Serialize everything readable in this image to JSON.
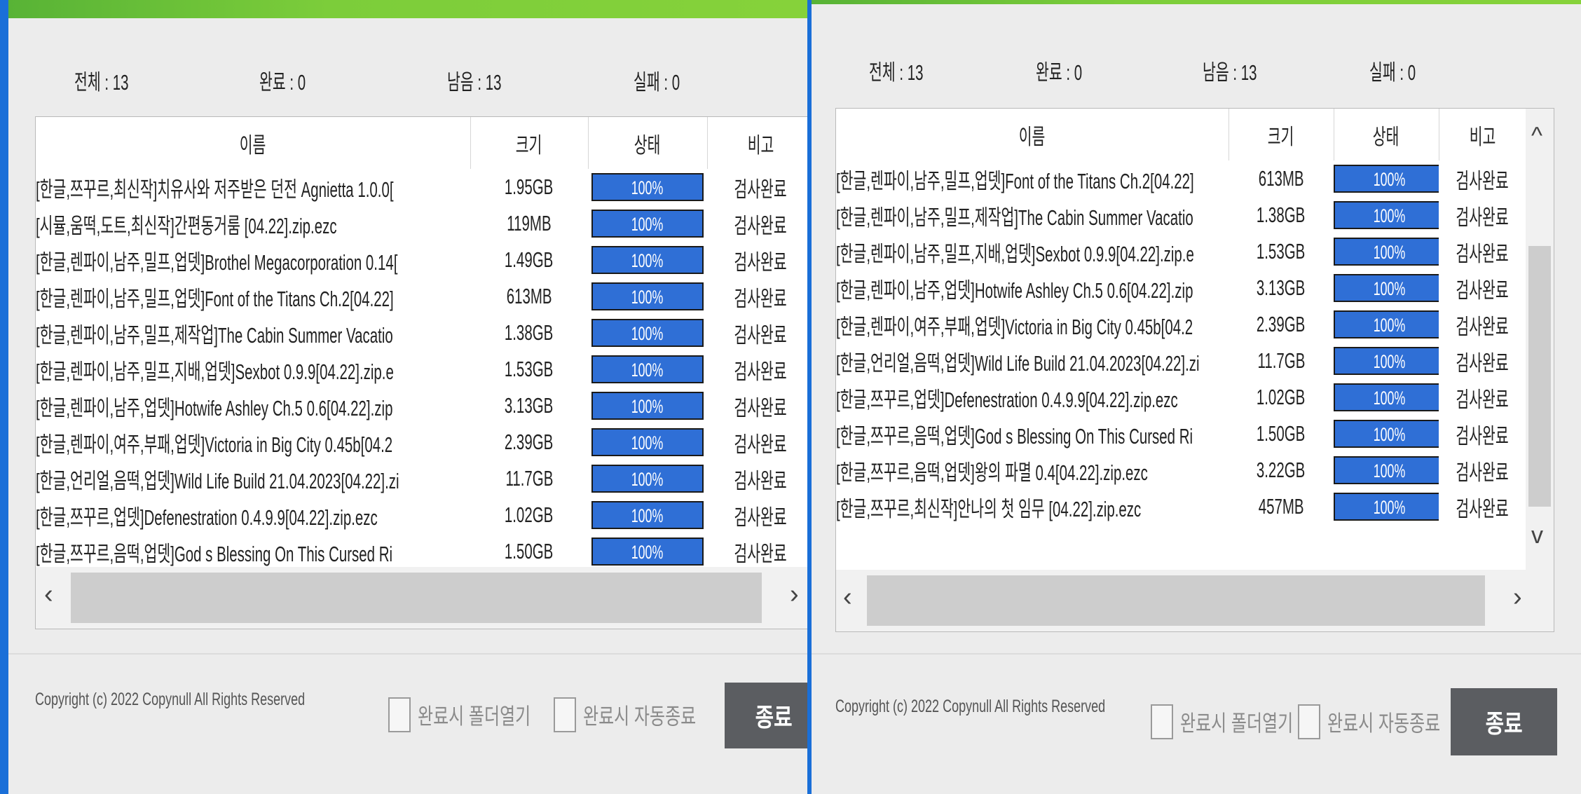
{
  "columns": [
    "이름",
    "크기",
    "상태",
    "비고"
  ],
  "left_window": {
    "stats": {
      "total_label": "전체",
      "total_value": "13",
      "done_label": "완료",
      "done_value": "0",
      "remain_label": "남음",
      "remain_value": "13",
      "fail_label": "실패",
      "fail_value": "0"
    },
    "rows": [
      {
        "name": "[한글,쯔꾸르,최신작]치유사와 저주받은 던전 Agnietta 1.0.0[",
        "size": "1.95GB",
        "progress": 100,
        "status": "100%",
        "note": "검사완료"
      },
      {
        "name": "[시뮬,움떡,도트,최신작]간편동거룸 [04.22].zip.ezc",
        "size": "119MB",
        "progress": 100,
        "status": "100%",
        "note": "검사완료"
      },
      {
        "name": "[한글,렌파이,남주,밀프,업뎃]Brothel Megacorporation 0.14[",
        "size": "1.49GB",
        "progress": 100,
        "status": "100%",
        "note": "검사완료"
      },
      {
        "name": "[한글,렌파이,남주,밀프,업뎃]Font of the Titans Ch.2[04.22]",
        "size": "613MB",
        "progress": 100,
        "status": "100%",
        "note": "검사완료"
      },
      {
        "name": "[한글,렌파이,남주,밀프,제작업]The Cabin Summer Vacatio",
        "size": "1.38GB",
        "progress": 100,
        "status": "100%",
        "note": "검사완료"
      },
      {
        "name": "[한글,렌파이,남주,밀프,지배,업뎃]Sexbot 0.9.9[04.22].zip.e",
        "size": "1.53GB",
        "progress": 100,
        "status": "100%",
        "note": "검사완료"
      },
      {
        "name": "[한글,렌파이,남주,업뎃]Hotwife Ashley Ch.5 0.6[04.22].zip",
        "size": "3.13GB",
        "progress": 100,
        "status": "100%",
        "note": "검사완료"
      },
      {
        "name": "[한글,렌파이,여주,부패,업뎃]Victoria in Big City 0.45b[04.2",
        "size": "2.39GB",
        "progress": 100,
        "status": "100%",
        "note": "검사완료"
      },
      {
        "name": "[한글,언리얼,음떡,업뎃]Wild Life Build 21.04.2023[04.22].zi",
        "size": "11.7GB",
        "progress": 100,
        "status": "100%",
        "note": "검사완료"
      },
      {
        "name": "[한글,쯔꾸르,업뎃]Defenestration 0.4.9.9[04.22].zip.ezc",
        "size": "1.02GB",
        "progress": 100,
        "status": "100%",
        "note": "검사완료"
      },
      {
        "name": "[한글,쯔꾸르,음떡,업뎃]God s Blessing On This Cursed Ri",
        "size": "1.50GB",
        "progress": 100,
        "status": "100%",
        "note": "검사완료"
      }
    ],
    "footer": {
      "copyright": "Copyright (c) 2022 Copynull All Rights Reserved",
      "open_folder_label": "완료시 폴더열기",
      "auto_exit_label": "완료시 자동종료",
      "exit_label": "종료"
    }
  },
  "right_window": {
    "stats": {
      "total_label": "전체",
      "total_value": "13",
      "done_label": "완료",
      "done_value": "0",
      "remain_label": "남음",
      "remain_value": "13",
      "fail_label": "실패",
      "fail_value": "0"
    },
    "rows": [
      {
        "name": "[한글,렌파이,남주,밀프,업뎃]Font of the Titans Ch.2[04.22]",
        "size": "613MB",
        "progress": 100,
        "status": "100%",
        "note": "검사완료"
      },
      {
        "name": "[한글,렌파이,남주,밀프,제작업]The Cabin Summer Vacatio",
        "size": "1.38GB",
        "progress": 100,
        "status": "100%",
        "note": "검사완료"
      },
      {
        "name": "[한글,렌파이,남주,밀프,지배,업뎃]Sexbot 0.9.9[04.22].zip.e",
        "size": "1.53GB",
        "progress": 100,
        "status": "100%",
        "note": "검사완료"
      },
      {
        "name": "[한글,렌파이,남주,업뎃]Hotwife Ashley Ch.5 0.6[04.22].zip",
        "size": "3.13GB",
        "progress": 100,
        "status": "100%",
        "note": "검사완료"
      },
      {
        "name": "[한글,렌파이,여주,부패,업뎃]Victoria in Big City 0.45b[04.2",
        "size": "2.39GB",
        "progress": 100,
        "status": "100%",
        "note": "검사완료"
      },
      {
        "name": "[한글,언리얼,음떡,업뎃]Wild Life Build 21.04.2023[04.22].zi",
        "size": "11.7GB",
        "progress": 100,
        "status": "100%",
        "note": "검사완료"
      },
      {
        "name": "[한글,쯔꾸르,업뎃]Defenestration 0.4.9.9[04.22].zip.ezc",
        "size": "1.02GB",
        "progress": 100,
        "status": "100%",
        "note": "검사완료"
      },
      {
        "name": "[한글,쯔꾸르,음떡,업뎃]God s Blessing On This Cursed Ri",
        "size": "1.50GB",
        "progress": 100,
        "status": "100%",
        "note": "검사완료"
      },
      {
        "name": "[한글,쯔꾸르,음떡,업뎃]왕의 파멸 0.4[04.22].zip.ezc",
        "size": "3.22GB",
        "progress": 100,
        "status": "100%",
        "note": "검사완료"
      },
      {
        "name": "[한글,쯔꾸르,최신작]안나의 첫 임무 [04.22].zip.ezc",
        "size": "457MB",
        "progress": 100,
        "status": "100%",
        "note": "검사완료"
      }
    ],
    "footer": {
      "copyright": "Copyright (c) 2022 Copynull All Rights Reserved",
      "open_folder_label": "완료시 폴더열기",
      "auto_exit_label": "완료시 자동종료",
      "exit_label": "종료"
    }
  },
  "icons": {
    "scroll_left": "‹",
    "scroll_right": "›",
    "scroll_up": "^",
    "scroll_down": "v"
  }
}
